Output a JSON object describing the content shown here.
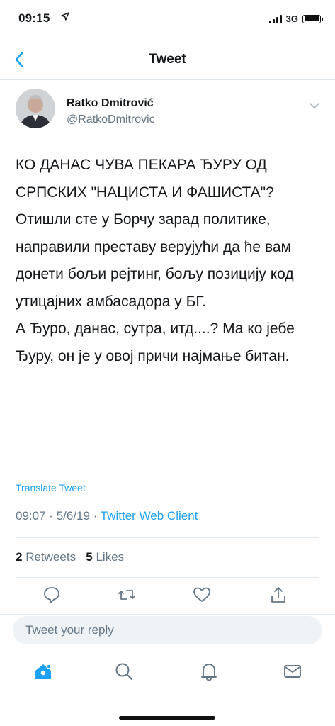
{
  "status_bar": {
    "time": "09:15",
    "network": "3G"
  },
  "nav": {
    "title": "Tweet"
  },
  "author": {
    "name": "Ratko Dmitrović",
    "handle": "@RatkoDmitrovic"
  },
  "tweet": {
    "text": "КО ДАНАС ЧУВА ПЕКАРА ЂУРУ ОД СРПСКИХ \"НАЦИСТА И ФАШИСТА\"?\nОтишли сте у Борчу зарад политике, направили преставу верујући да ће вам донети бољи рејтинг, бољу позицију код утицајних амбасадора у БГ.\nА Ђуро, данас, сутра, итд....? Ма ко јебе Ђуру, он је у овој причи најмање битан.",
    "translate_label": "Translate Tweet",
    "time": "09:07",
    "date": "5/6/19",
    "separator": "·",
    "client": "Twitter Web Client"
  },
  "stats": {
    "retweets_count": "2",
    "retweets_label": "Retweets",
    "likes_count": "5",
    "likes_label": "Likes"
  },
  "actions": [
    "reply-icon",
    "retweet-icon",
    "like-icon",
    "share-icon"
  ],
  "reply": {
    "placeholder": "Tweet your reply"
  },
  "tab_bar": [
    "home-icon",
    "search-icon",
    "notifications-icon",
    "messages-icon"
  ],
  "colors": {
    "accent": "#1da1f2",
    "secondary_text": "#657786",
    "divider": "#e1e8ed"
  }
}
